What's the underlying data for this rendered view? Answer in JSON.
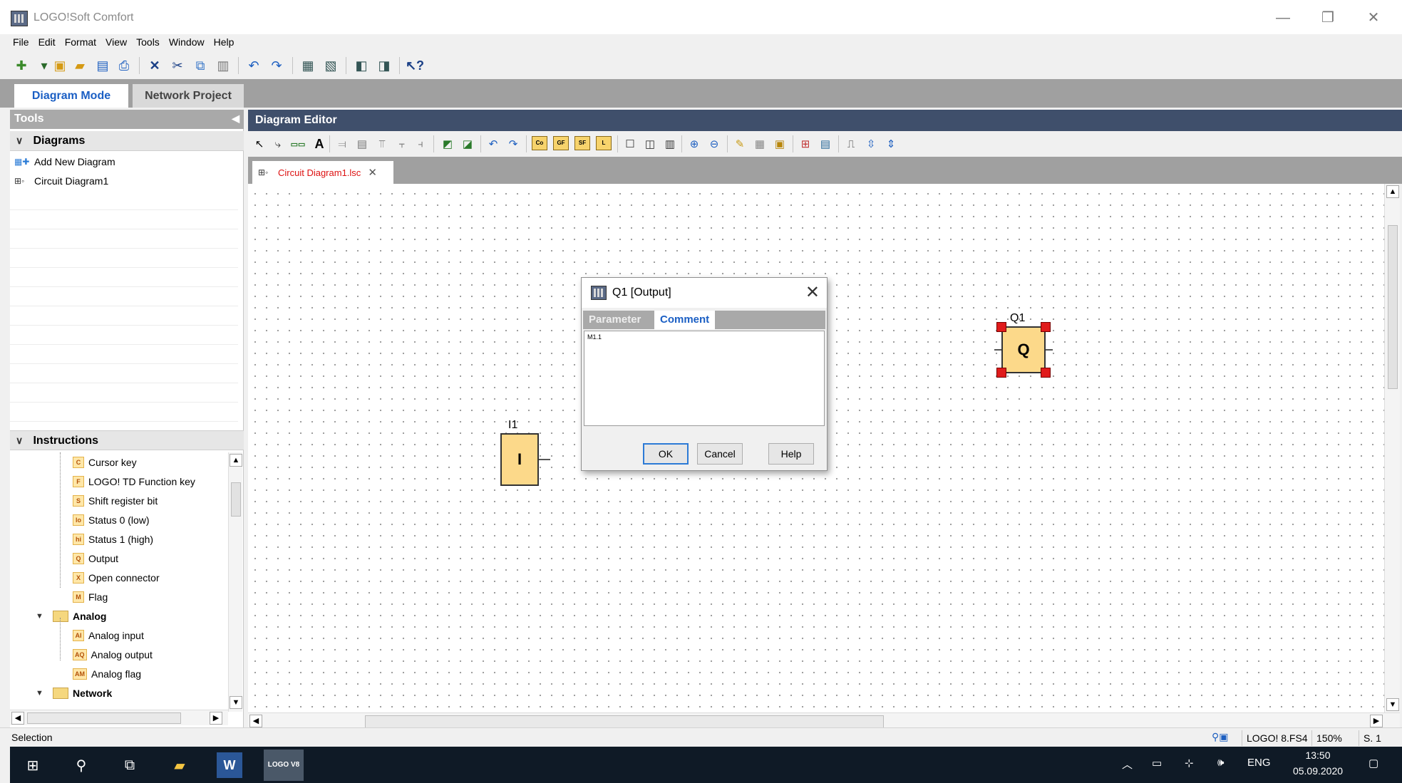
{
  "window": {
    "title": "LOGO!Soft Comfort",
    "minimize": "—",
    "restore": "❐",
    "close": "✕"
  },
  "menu": [
    "File",
    "Edit",
    "Format",
    "View",
    "Tools",
    "Window",
    "Help"
  ],
  "mode_tabs": {
    "diagram_mode": "Diagram Mode",
    "network_project": "Network Project"
  },
  "tools_panel": {
    "title": "Tools",
    "collapse": "◀",
    "diagrams_header": "Diagrams",
    "diagram_items": [
      "Add New Diagram",
      "Circuit Diagram1"
    ],
    "instructions_header": "Instructions",
    "instructions": [
      {
        "badge": "C",
        "label": "Cursor key"
      },
      {
        "badge": "F",
        "label": "LOGO! TD Function key"
      },
      {
        "badge": "S",
        "label": "Shift register bit"
      },
      {
        "badge": "lo",
        "label": "Status 0 (low)"
      },
      {
        "badge": "hi",
        "label": "Status 1 (high)"
      },
      {
        "badge": "Q",
        "label": "Output"
      },
      {
        "badge": "X",
        "label": "Open connector"
      },
      {
        "badge": "M",
        "label": "Flag"
      }
    ],
    "analog_folder": "Analog",
    "analog_items": [
      {
        "badge": "AI",
        "label": "Analog input"
      },
      {
        "badge": "AQ",
        "label": "Analog output"
      },
      {
        "badge": "AM",
        "label": "Analog flag"
      }
    ],
    "network_folder": "Network"
  },
  "editor": {
    "title": "Diagram Editor",
    "doc_tab": "Circuit Diagram1.lsc",
    "doc_tab_close": "✕"
  },
  "blocks": {
    "input": {
      "label": "I1",
      "symbol": "I"
    },
    "output": {
      "label": "Q1",
      "symbol": "Q"
    }
  },
  "dialog": {
    "title": "Q1 [Output]",
    "close": "✕",
    "tabs": [
      "Parameter",
      "Comment"
    ],
    "active_tab": "Comment",
    "comment_text": "M1.1",
    "ok": "OK",
    "cancel": "Cancel",
    "help": "Help"
  },
  "status": {
    "left": "Selection",
    "device": "LOGO! 8.FS4",
    "zoom": "150%",
    "page": "S. 1"
  },
  "taskbar": {
    "lang": "ENG",
    "time": "13:50",
    "date": "05.09.2020",
    "logo_app": "LOGO V8"
  }
}
